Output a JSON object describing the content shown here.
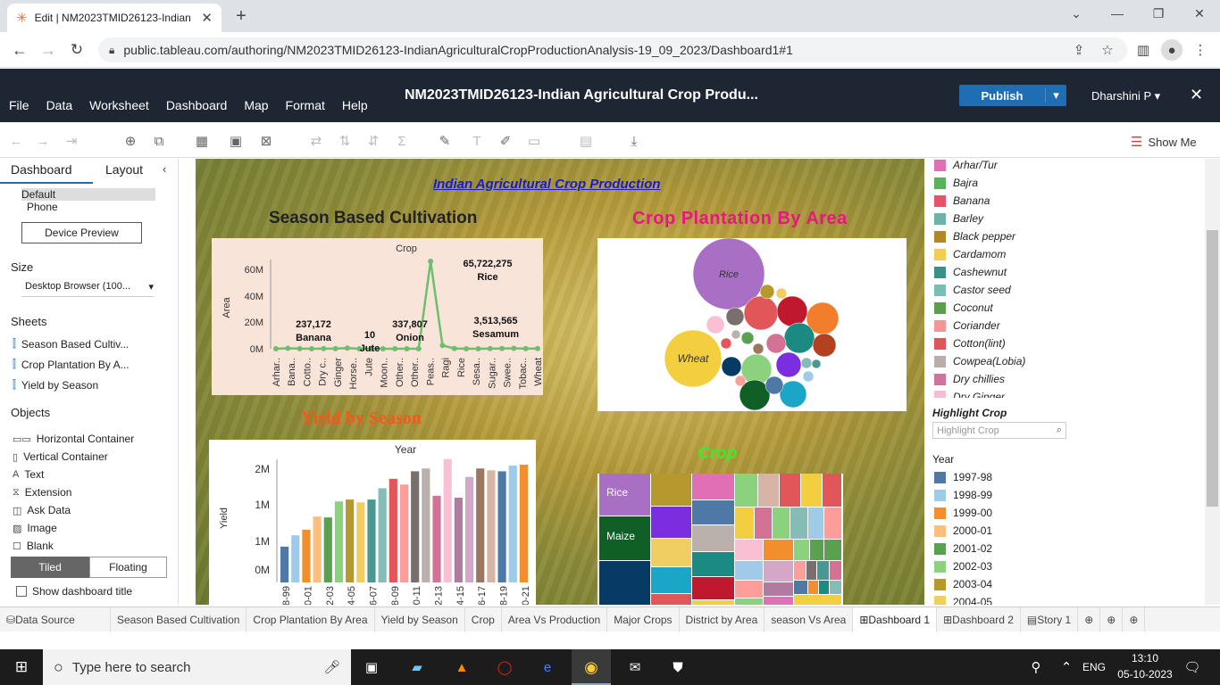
{
  "browser": {
    "tab_title": "Edit | NM2023TMID26123-Indian",
    "url": "public.tableau.com/authoring/NM2023TMID26123-IndianAgriculturalCropProductionAnalysis-19_09_2023/Dashboard1#1"
  },
  "tableau": {
    "menus": [
      "File",
      "Data",
      "Worksheet",
      "Dashboard",
      "Map",
      "Format",
      "Help"
    ],
    "workbook_title": "NM2023TMID26123-Indian Agricultural Crop Produ...",
    "publish_label": "Publish",
    "user": "Dharshini P",
    "show_me": "Show Me"
  },
  "left_pane": {
    "tabs": [
      "Dashboard",
      "Layout"
    ],
    "devices": [
      "Default",
      "Phone"
    ],
    "device_preview": "Device Preview",
    "size_heading": "Size",
    "size_value": "Desktop Browser (100...",
    "sheets_heading": "Sheets",
    "sheets": [
      "Season Based Cultiv...",
      "Crop Plantation By A...",
      "Yield by Season"
    ],
    "objects_heading": "Objects",
    "objects": [
      "Horizontal Container",
      "Vertical Container",
      "Text",
      "Extension",
      "Ask Data",
      "Image",
      "Blank"
    ],
    "tiled": "Tiled",
    "floating": "Floating",
    "show_title": "Show dashboard title"
  },
  "dashboard": {
    "title": "Indian Agricultural Crop Production",
    "season_heading": "Season Based Cultivation",
    "plantation_heading": "Crop Plantation By Area",
    "yield_heading": "Yield by Season",
    "crop_heading": "Crop"
  },
  "chart_data": [
    {
      "type": "line",
      "title": "Crop",
      "ylabel": "Area",
      "yticks": [
        "60M",
        "40M",
        "20M",
        "0M"
      ],
      "categories": [
        "Arhar..",
        "Bana..",
        "Cotto..",
        "Dry c..",
        "Ginger",
        "Horse..",
        "Jute",
        "Moon..",
        "Other..",
        "Other..",
        "Peas..",
        "Ragi",
        "Rice",
        "Sesa..",
        "Sugar..",
        "Swee..",
        "Tobac..",
        "Wheat"
      ],
      "annotations": [
        {
          "value": "237,172",
          "label": "Banana"
        },
        {
          "value": "10",
          "label": "Jute"
        },
        {
          "value": "337,807",
          "label": "Onion"
        },
        {
          "value": "65,722,275",
          "label": "Rice"
        },
        {
          "value": "3,513,565",
          "label": "Sesamum"
        }
      ],
      "color": "#6dbf6d"
    },
    {
      "type": "scatter",
      "title": "Crop Plantation By Area",
      "labels": [
        "Rice",
        "Wheat"
      ]
    },
    {
      "type": "bar",
      "title": "Year",
      "ylabel": "Yield",
      "yticks": [
        "2M",
        "1M",
        "1M",
        "0M"
      ],
      "xticks": [
        "8-99",
        "0-01",
        "2-03",
        "4-05",
        "6-07",
        "8-09",
        "0-11",
        "2-13",
        "4-15",
        "6-17",
        "8-19",
        "0-21"
      ],
      "values": [
        0.38,
        0.5,
        0.56,
        0.7,
        0.69,
        0.86,
        0.88,
        0.85,
        0.88,
        1.0,
        1.1,
        1.04,
        1.18,
        1.21,
        0.92,
        1.31,
        0.9,
        1.12,
        1.21,
        1.19,
        1.18,
        1.24,
        1.25
      ],
      "colors": [
        "#4e79a7",
        "#a0cbe8",
        "#f28e2b",
        "#ffbe7d",
        "#59a14f",
        "#8cd17d",
        "#b6992d",
        "#f1ce63",
        "#499894",
        "#86bcb6",
        "#e15759",
        "#ff9d9a",
        "#79706e",
        "#bab0ac",
        "#d37295",
        "#fabfd2",
        "#b07aa1",
        "#d4a6c8",
        "#9d7660",
        "#d7b5a6",
        "#4e79a7",
        "#a0cbe8",
        "#f28e2b"
      ]
    },
    {
      "type": "heatmap",
      "title": "Crop",
      "labels": [
        "Rice",
        "Maize"
      ]
    }
  ],
  "right_pane": {
    "legend": [
      {
        "name": "Arhar/Tur",
        "color": "#e06fb5"
      },
      {
        "name": "Bajra",
        "color": "#59b35c"
      },
      {
        "name": "Banana",
        "color": "#e8526b"
      },
      {
        "name": "Barley",
        "color": "#6cb3aa"
      },
      {
        "name": "Black pepper",
        "color": "#b08a20"
      },
      {
        "name": "Cardamom",
        "color": "#f3cd52"
      },
      {
        "name": "Cashewnut",
        "color": "#3a9188"
      },
      {
        "name": "Castor seed",
        "color": "#7abdb2"
      },
      {
        "name": "Coconut",
        "color": "#5b9f4c"
      },
      {
        "name": "Coriander",
        "color": "#f59595"
      },
      {
        "name": "Cotton(lint)",
        "color": "#e15459"
      },
      {
        "name": "Cowpea(Lobia)",
        "color": "#b9aea9"
      },
      {
        "name": "Dry chillies",
        "color": "#d0729a"
      },
      {
        "name": "Dry Ginger",
        "color": "#f7bcd0"
      }
    ],
    "highlight_heading": "Highlight Crop",
    "highlight_placeholder": "Highlight Crop",
    "year_heading": "Year",
    "years": [
      {
        "name": "1997-98",
        "color": "#4e79a7"
      },
      {
        "name": "1998-99",
        "color": "#a0cbe8"
      },
      {
        "name": "1999-00",
        "color": "#f28e2b"
      },
      {
        "name": "2000-01",
        "color": "#ffbe7d"
      },
      {
        "name": "2001-02",
        "color": "#59a14f"
      },
      {
        "name": "2002-03",
        "color": "#8cd17d"
      },
      {
        "name": "2003-04",
        "color": "#b6992d"
      },
      {
        "name": "2004-05",
        "color": "#f1ce63"
      }
    ]
  },
  "sheet_tabs": [
    "Data Source",
    "Season Based Cultivation",
    "Crop Plantation By Area",
    "Yield by Season",
    "Crop",
    "Area Vs Production",
    "Major Crops",
    "District by Area",
    "season Vs Area",
    "Dashboard 1",
    "Dashboard 2",
    "Story 1"
  ],
  "taskbar": {
    "search": "Type here to search",
    "lang": "ENG",
    "time": "13:10",
    "date": "05-10-2023"
  }
}
